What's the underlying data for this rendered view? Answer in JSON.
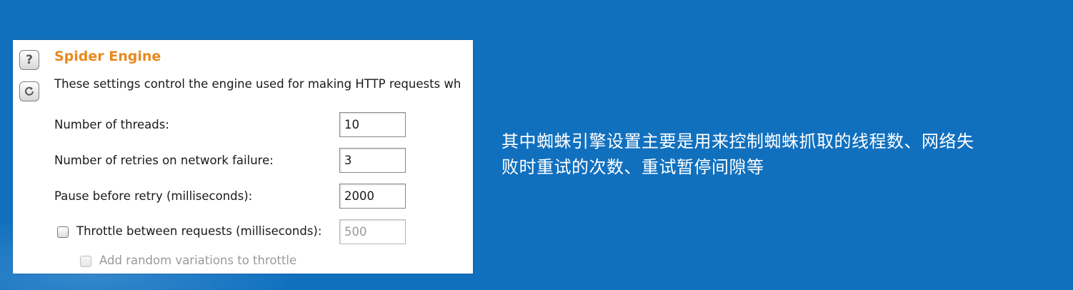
{
  "panel": {
    "title": "Spider Engine",
    "description": "These settings control the engine used for making HTTP requests wh",
    "icons": {
      "help": "help-icon",
      "reset": "reset-icon"
    },
    "fields": [
      {
        "label": "Number of threads:",
        "value": "10"
      },
      {
        "label": "Number of retries on network failure:",
        "value": "3"
      },
      {
        "label": "Pause before retry (milliseconds):",
        "value": "2000"
      }
    ],
    "throttle": {
      "label": "Throttle between requests (milliseconds):",
      "value": "500",
      "checked": false
    },
    "random_variations": {
      "label": "Add random variations to throttle",
      "checked": false,
      "disabled": true
    }
  },
  "caption": {
    "line1": "其中蜘蛛引擎设置主要是用来控制蜘蛛抓取的线程数、网络失",
    "line2": "败时重试的次数、重试暂停间隙等"
  },
  "colors": {
    "background": "#1170be",
    "title": "#e8891d"
  }
}
